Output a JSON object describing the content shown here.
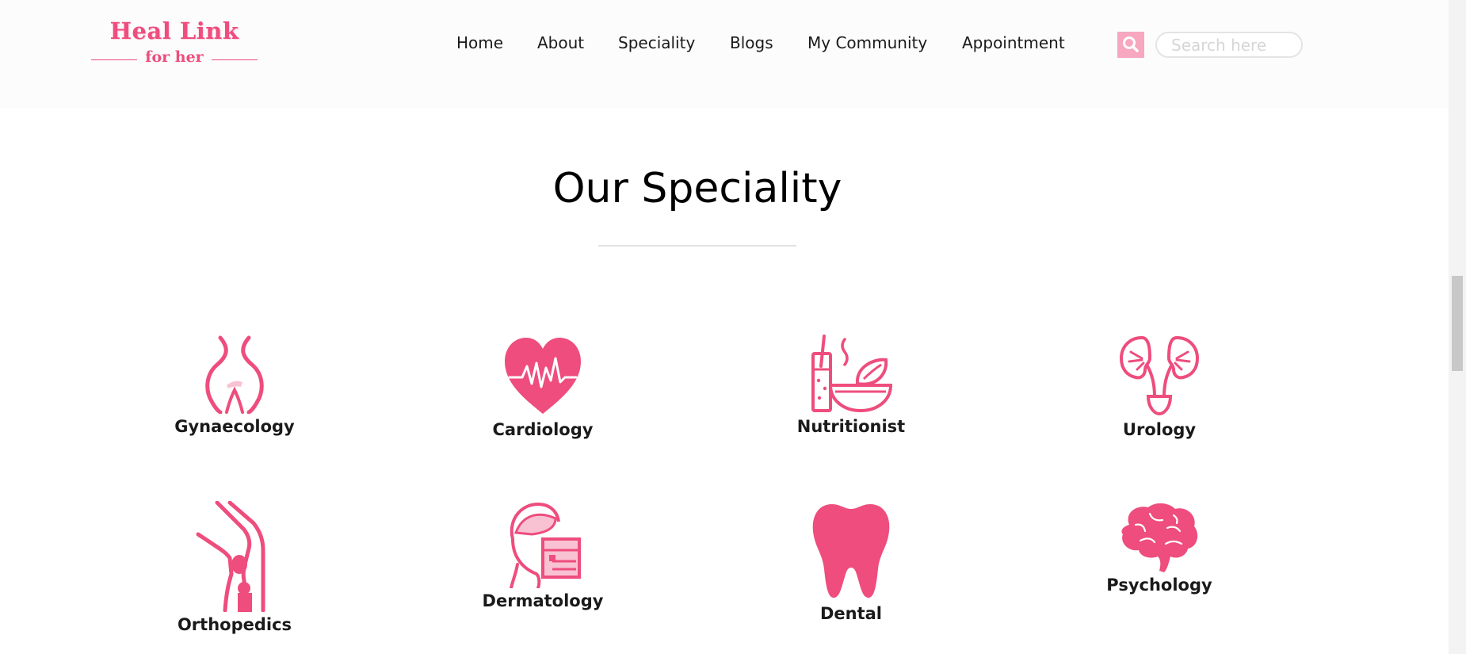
{
  "brand": {
    "title": "Heal Link",
    "subtitle": "for her",
    "color": "#ee4d7d"
  },
  "nav": {
    "items": [
      {
        "label": "Home"
      },
      {
        "label": "About"
      },
      {
        "label": "Speciality"
      },
      {
        "label": "Blogs"
      },
      {
        "label": "My Community"
      },
      {
        "label": "Appointment"
      }
    ]
  },
  "search": {
    "icon": "search-icon",
    "placeholder": "Search here",
    "value": ""
  },
  "section": {
    "title": "Our Speciality"
  },
  "specialities": [
    {
      "label": "Gynaecology",
      "icon": "pelvis-icon"
    },
    {
      "label": "Cardiology",
      "icon": "heart-pulse-icon"
    },
    {
      "label": "Nutritionist",
      "icon": "food-bowl-icon"
    },
    {
      "label": "Urology",
      "icon": "kidney-icon"
    },
    {
      "label": "Orthopedics",
      "icon": "knee-joint-icon"
    },
    {
      "label": "Dermatology",
      "icon": "face-skin-icon"
    },
    {
      "label": "Dental",
      "icon": "tooth-icon"
    },
    {
      "label": "Psychology",
      "icon": "brain-icon"
    }
  ],
  "colors": {
    "accent": "#ee4d7d",
    "accent_light": "#f7a7bf",
    "header_bg": "#fcfcfc"
  }
}
